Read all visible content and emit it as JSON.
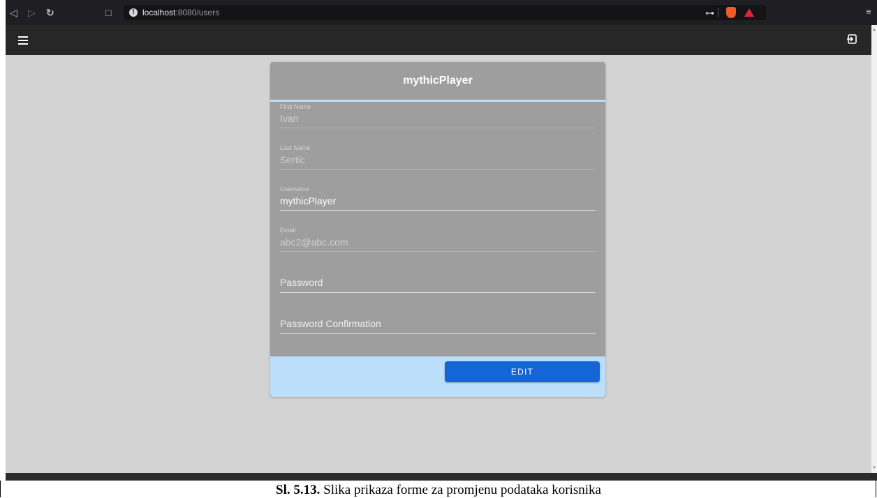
{
  "browser": {
    "url_host": "localhost",
    "url_path": ":8080/users",
    "back_icon": "back-arrow-icon",
    "forward_icon": "forward-arrow-icon",
    "reload_icon": "reload-icon",
    "bookmark_icon": "bookmark-icon",
    "key_icon": "key-icon",
    "brave_icon": "brave-shield-icon",
    "rewards_icon": "rewards-icon",
    "menu_icon": "menu-icon"
  },
  "app_bar": {
    "menu_icon": "hamburger-icon",
    "logout_icon": "logout-icon"
  },
  "card": {
    "title": "mythicPlayer",
    "fields": [
      {
        "label": "First Name",
        "value": "Ivan"
      },
      {
        "label": "Last Name",
        "value": "Sertic"
      },
      {
        "label": "Username",
        "value": "mythicPlayer"
      },
      {
        "label": "Email",
        "value": "abc2@abc.com"
      },
      {
        "placeholder": "Password"
      },
      {
        "placeholder": "Password Confirmation"
      }
    ],
    "edit_label": "EDIT"
  },
  "caption": {
    "number": "Sl. 5.13.",
    "text": " Slika prikaza forme za promjenu podataka korisnika"
  },
  "colors": {
    "card": "#9e9e9e",
    "actions": "#bbdefb",
    "button": "#1565d8",
    "background": "#d3d3d3",
    "app_bar": "#272727"
  }
}
